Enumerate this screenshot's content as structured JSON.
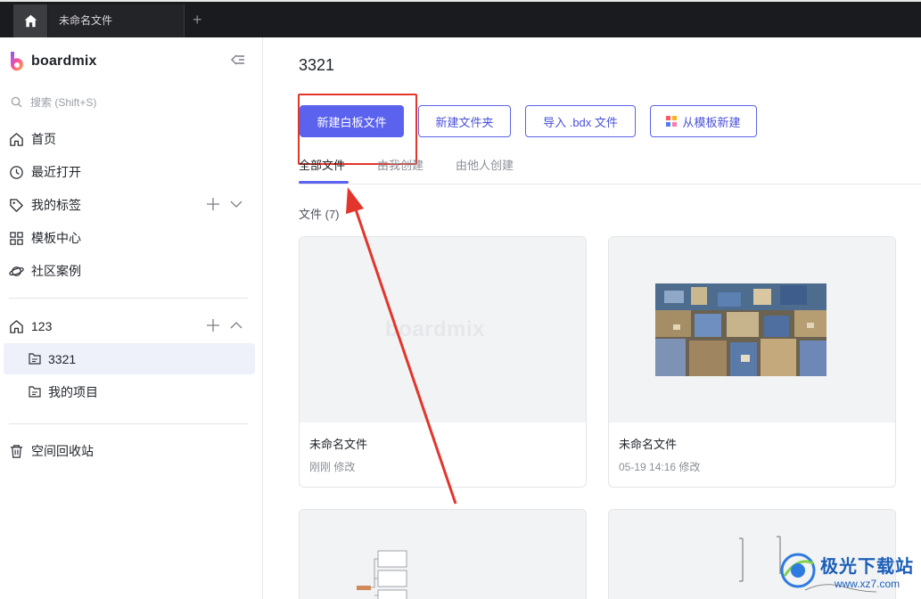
{
  "window": {
    "tab_title": "未命名文件",
    "add_tab": "+"
  },
  "sidebar": {
    "brand": "boardmix",
    "search_placeholder": "搜索 (Shift+S)",
    "nav": [
      {
        "label": "首页",
        "icon": "home-icon"
      },
      {
        "label": "最近打开",
        "icon": "clock-icon"
      },
      {
        "label": "我的标签",
        "icon": "tag-icon"
      },
      {
        "label": "模板中心",
        "icon": "grid-icon"
      },
      {
        "label": "社区案例",
        "icon": "planet-icon"
      }
    ],
    "team": {
      "label": "123",
      "icon": "home-icon"
    },
    "projects": [
      {
        "label": "3321",
        "active": true
      },
      {
        "label": "我的项目",
        "active": false
      }
    ],
    "trash": "空间回收站"
  },
  "main": {
    "title": "3321",
    "buttons": {
      "new_board": "新建白板文件",
      "new_folder": "新建文件夹",
      "import": "导入 .bdx 文件",
      "from_template": "从模板新建"
    },
    "tabs": [
      "全部文件",
      "由我创建",
      "由他人创建"
    ],
    "section_label": "文件 (7)",
    "files": [
      {
        "name": "未命名文件",
        "meta": "刚刚 修改",
        "thumb_watermark": "boardmix"
      },
      {
        "name": "未命名文件",
        "meta": "05-19 14:16 修改"
      }
    ]
  },
  "watermark": {
    "line1": "极光下载站",
    "line2": "www.xz7.com"
  },
  "colors": {
    "accent": "#5b62ee",
    "annotation": "#e2352b"
  }
}
